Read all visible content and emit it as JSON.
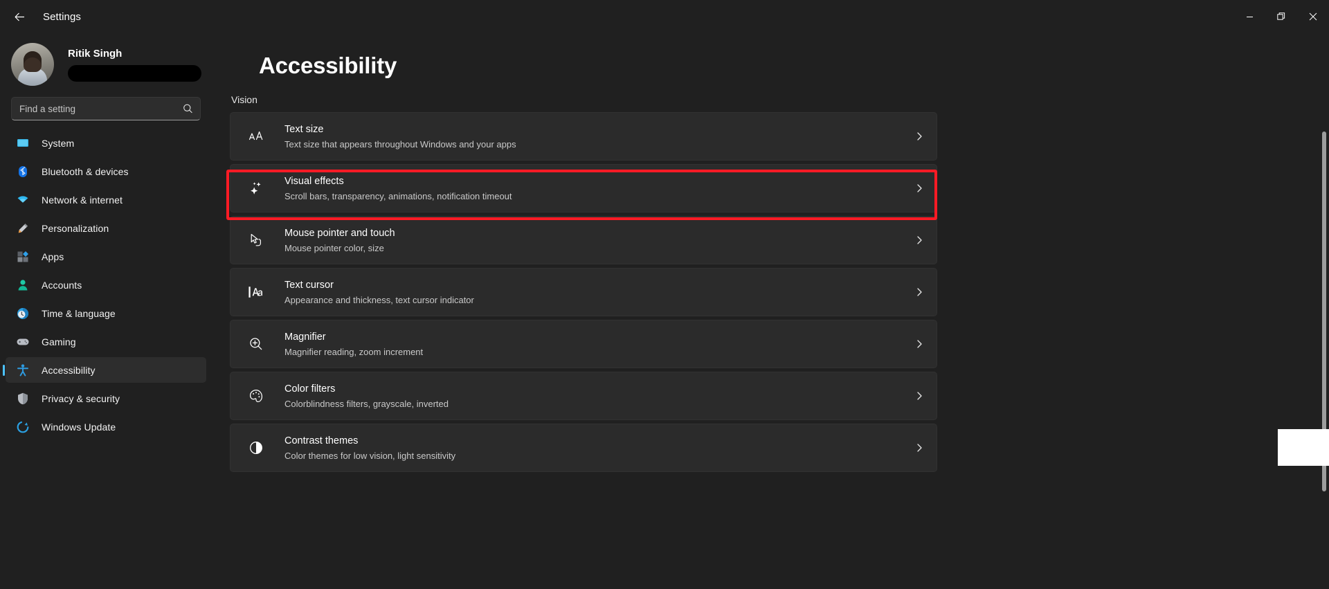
{
  "window": {
    "title": "Settings",
    "back_icon": "back-arrow-icon",
    "controls": [
      {
        "name": "minimize",
        "glyph": "minimize-icon"
      },
      {
        "name": "restore",
        "glyph": "restore-icon"
      },
      {
        "name": "close",
        "glyph": "close-icon"
      }
    ]
  },
  "sidebar": {
    "profile": {
      "name": "Ritik Singh",
      "email_redacted": true,
      "avatar": "user-avatar"
    },
    "search": {
      "placeholder": "Find a setting",
      "value": "",
      "icon": "search-icon"
    },
    "items": [
      {
        "label": "System",
        "icon": "system-icon",
        "selected": false
      },
      {
        "label": "Bluetooth & devices",
        "icon": "bluetooth-icon",
        "selected": false
      },
      {
        "label": "Network & internet",
        "icon": "network-icon",
        "selected": false
      },
      {
        "label": "Personalization",
        "icon": "personalization-icon",
        "selected": false
      },
      {
        "label": "Apps",
        "icon": "apps-icon",
        "selected": false
      },
      {
        "label": "Accounts",
        "icon": "accounts-icon",
        "selected": false
      },
      {
        "label": "Time & language",
        "icon": "time-language-icon",
        "selected": false
      },
      {
        "label": "Gaming",
        "icon": "gaming-icon",
        "selected": false
      },
      {
        "label": "Accessibility",
        "icon": "accessibility-icon",
        "selected": true
      },
      {
        "label": "Privacy & security",
        "icon": "privacy-security-icon",
        "selected": false
      },
      {
        "label": "Windows Update",
        "icon": "windows-update-icon",
        "selected": false
      }
    ]
  },
  "main": {
    "page_title": "Accessibility",
    "section_label": "Vision",
    "cards": [
      {
        "title": "Text size",
        "subtitle": "Text size that appears throughout Windows and your apps",
        "icon": "text-size-icon",
        "highlighted": false
      },
      {
        "title": "Visual effects",
        "subtitle": "Scroll bars, transparency, animations, notification timeout",
        "icon": "sparkles-icon",
        "highlighted": true
      },
      {
        "title": "Mouse pointer and touch",
        "subtitle": "Mouse pointer color, size",
        "icon": "mouse-pointer-icon",
        "highlighted": false
      },
      {
        "title": "Text cursor",
        "subtitle": "Appearance and thickness, text cursor indicator",
        "icon": "text-cursor-icon",
        "highlighted": false
      },
      {
        "title": "Magnifier",
        "subtitle": "Magnifier reading, zoom increment",
        "icon": "magnifier-icon",
        "highlighted": false
      },
      {
        "title": "Color filters",
        "subtitle": "Colorblindness filters, grayscale, inverted",
        "icon": "color-filters-icon",
        "highlighted": false
      },
      {
        "title": "Contrast themes",
        "subtitle": "Color themes for low vision, light sensitivity",
        "icon": "contrast-themes-icon",
        "highlighted": false
      }
    ],
    "chevron_icon": "chevron-right-icon"
  },
  "colors": {
    "accent": "#4cc2ff",
    "highlight": "#ff1b25",
    "background": "#202020",
    "card": "#2b2b2b"
  }
}
